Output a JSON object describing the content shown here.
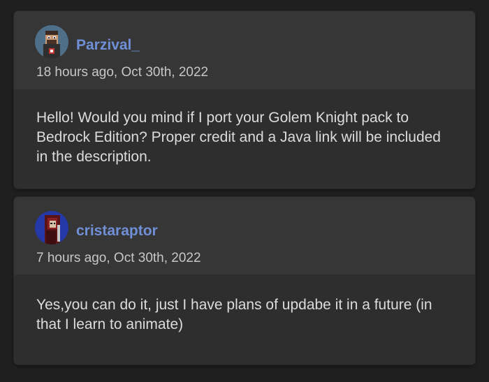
{
  "comments": [
    {
      "username": "Parzival_",
      "timestamp": "18 hours ago, Oct 30th, 2022",
      "body": "Hello! Would you mind if I port your Golem Knight pack to Bedrock Edition? Proper credit and a Java link will be included in the description.",
      "avatar_icon": "pixel-character-avatar-icon"
    },
    {
      "username": "cristaraptor",
      "timestamp": "7 hours ago, Oct 30th, 2022",
      "body": "Yes,you can do it, just I have plans of updabe it in a future (in that I learn to animate)",
      "avatar_icon": "pixel-character-avatar-icon"
    }
  ],
  "colors": {
    "background": "#1f1f1f",
    "card": "#2e2e2e",
    "card_header": "#363636",
    "username": "#6f8fd6",
    "timestamp": "#c7c7c7",
    "body_text": "#dcdcdc"
  }
}
